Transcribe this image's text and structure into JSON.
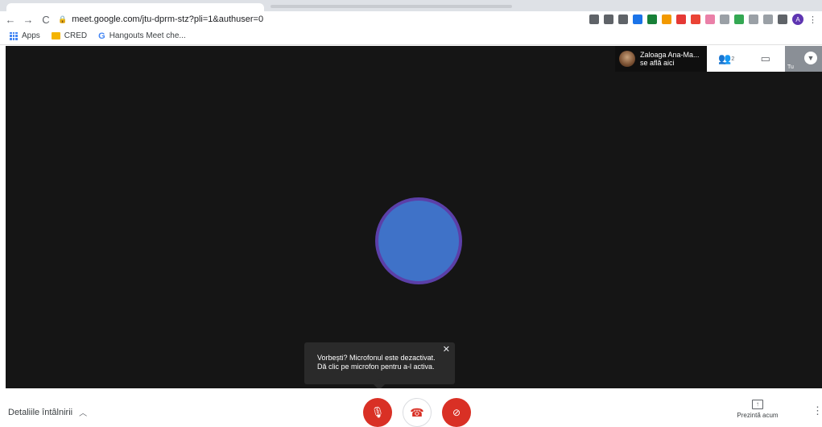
{
  "browser": {
    "url": "meet.google.com/jtu-dprm-stz?pli=1&authuser=0",
    "profile_initial": "A",
    "bookmarks": [
      {
        "label": "Apps"
      },
      {
        "label": "CRED"
      },
      {
        "label": "Hangouts Meet che..."
      }
    ],
    "extensions": [
      {
        "name": "cast-icon",
        "color": "#5f6368"
      },
      {
        "name": "translate-icon",
        "color": "#5f6368"
      },
      {
        "name": "star-icon",
        "color": "#5f6368"
      },
      {
        "name": "ext-blue-icon",
        "color": "#1a73e8"
      },
      {
        "name": "ext-green-icon",
        "color": "#188038"
      },
      {
        "name": "ext-new-icon",
        "color": "#f29900"
      },
      {
        "name": "opera-icon",
        "color": "#e53935"
      },
      {
        "name": "ext-badge-icon",
        "color": "#ea4335"
      },
      {
        "name": "ext-tag-icon",
        "color": "#ea80a8"
      },
      {
        "name": "ext-gray-icon",
        "color": "#9aa0a6"
      },
      {
        "name": "drive-icon",
        "color": "#34a853"
      },
      {
        "name": "ext-circle-icon",
        "color": "#9aa0a6"
      },
      {
        "name": "camera-icon",
        "color": "#9aa0a6"
      },
      {
        "name": "cast-tab-icon",
        "color": "#5f6368"
      }
    ]
  },
  "meeting": {
    "participant_name": "Zaloaga Ana-Ma...",
    "participant_status": "se află aici",
    "people_count": "2",
    "self_label": "Tu",
    "toast_line1": "Vorbești? Microfonul este dezactivat.",
    "toast_line2": "Dă clic pe microfon pentru a-l activa.",
    "toast_close": "✕",
    "details_label": "Detaliile întâlnirii",
    "present_label": "Prezintă acum",
    "avatar_colors": {
      "outer": "#5b3fa8",
      "inner": "#3f72c8"
    }
  }
}
